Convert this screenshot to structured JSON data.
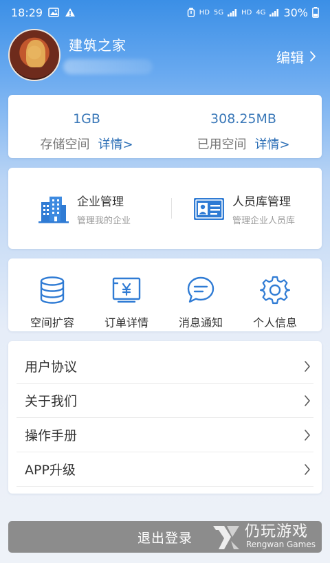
{
  "status_bar": {
    "time": "18:29",
    "network_hd_1": "HD",
    "network_5g": "5G",
    "network_hd_2": "HD",
    "network_4g": "4G",
    "battery": "30%"
  },
  "profile": {
    "username": "建筑之家",
    "edit_label": "编辑"
  },
  "storage": {
    "total_value": "1GB",
    "total_label": "存储空间",
    "used_value": "308.25MB",
    "used_label": "已用空间",
    "detail_label": "详情>"
  },
  "manage": {
    "enterprise_title": "企业管理",
    "enterprise_sub": "管理我的企业",
    "staff_title": "人员库管理",
    "staff_sub": "管理企业人员库"
  },
  "actions": [
    {
      "label": "空间扩容",
      "icon": "database-icon"
    },
    {
      "label": "订单详情",
      "icon": "order-yen-icon"
    },
    {
      "label": "消息通知",
      "icon": "message-icon"
    },
    {
      "label": "个人信息",
      "icon": "gear-icon"
    }
  ],
  "menu": [
    {
      "label": "用户协议"
    },
    {
      "label": "关于我们"
    },
    {
      "label": "操作手册"
    },
    {
      "label": "APP升级"
    }
  ],
  "logout_label": "退出登录",
  "watermark": {
    "title": "仍玩游戏",
    "subtitle": "Rengwan Games"
  },
  "colors": {
    "header_blue": "#3b8fe6",
    "accent_blue": "#2a6db5",
    "icon_blue": "#2f7bd4",
    "logout_gray": "#8c8c8c"
  }
}
